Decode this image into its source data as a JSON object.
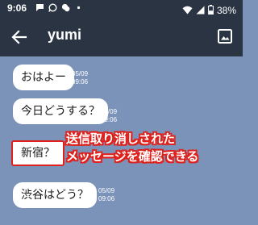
{
  "status_bar": {
    "time": "9:06",
    "battery": "38%",
    "left_icons": [
      "chat-bubble-icon",
      "whatsapp-icon",
      "chat-icon",
      "dot-icon"
    ],
    "right_icons": [
      "wifi-icon",
      "signal-icon",
      "battery-icon"
    ]
  },
  "app_bar": {
    "title": "yumi",
    "back_icon": "arrow-left-icon",
    "image_icon": "image-icon"
  },
  "messages": [
    {
      "text": "おはよー",
      "date": "05/09",
      "time": "09:06"
    },
    {
      "text": "今日どうする？",
      "date": "05/09",
      "time": "09:06"
    },
    {
      "text": "新宿？",
      "date": "",
      "time": "",
      "highlighted": true
    },
    {
      "text": "渋谷はどう？",
      "date": "05/09",
      "time": "09:06"
    }
  ],
  "annotation": {
    "line1": "送信取り消しされた",
    "line2": "メッセージを確認できる",
    "color": "#e0201a"
  },
  "colors": {
    "header_bg": "#2a3442",
    "chat_bg": "#7b93b8",
    "bubble_bg": "#ffffff",
    "highlight": "#e0201a"
  }
}
